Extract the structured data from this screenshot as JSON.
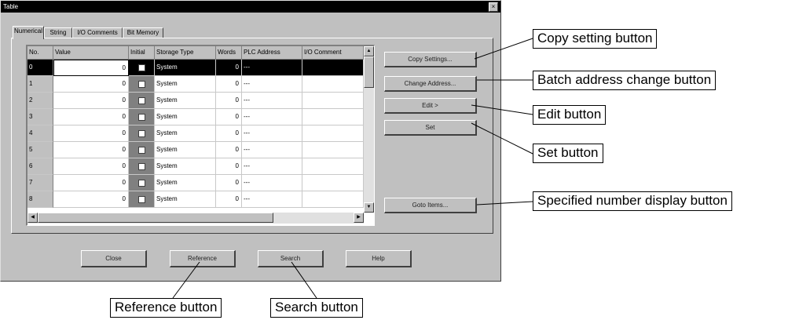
{
  "window": {
    "title": "Table",
    "close_glyph": "×"
  },
  "tabs": [
    {
      "label": "Numerical"
    },
    {
      "label": "String"
    },
    {
      "label": "I/O Comments"
    },
    {
      "label": "Bit Memory"
    }
  ],
  "grid": {
    "columns": [
      "No.",
      "Value",
      "Initial",
      "Storage Type",
      "Words",
      "PLC Address",
      "I/O Comment"
    ],
    "rows": [
      {
        "no": "0",
        "value": "0",
        "storage": "System",
        "words": "0",
        "address": "---"
      },
      {
        "no": "1",
        "value": "0",
        "storage": "System",
        "words": "0",
        "address": "---"
      },
      {
        "no": "2",
        "value": "0",
        "storage": "System",
        "words": "0",
        "address": "---"
      },
      {
        "no": "3",
        "value": "0",
        "storage": "System",
        "words": "0",
        "address": "---"
      },
      {
        "no": "4",
        "value": "0",
        "storage": "System",
        "words": "0",
        "address": "---"
      },
      {
        "no": "5",
        "value": "0",
        "storage": "System",
        "words": "0",
        "address": "---"
      },
      {
        "no": "6",
        "value": "0",
        "storage": "System",
        "words": "0",
        "address": "---"
      },
      {
        "no": "7",
        "value": "0",
        "storage": "System",
        "words": "0",
        "address": "---"
      },
      {
        "no": "8",
        "value": "0",
        "storage": "System",
        "words": "0",
        "address": "---"
      }
    ],
    "selected_row": 0
  },
  "side_buttons": {
    "copy": "Copy Settings...",
    "change_address": "Change Address...",
    "edit": "Edit >",
    "set": "Set",
    "goto": "Goto Items..."
  },
  "bottom_buttons": {
    "close": "Close",
    "reference": "Reference",
    "search": "Search",
    "help": "Help"
  },
  "callouts": {
    "copy": "Copy setting button",
    "batch": "Batch address change button",
    "edit": "Edit button",
    "set": "Set button",
    "specified": "Specified number display button",
    "reference": "Reference button",
    "search": "Search button"
  }
}
